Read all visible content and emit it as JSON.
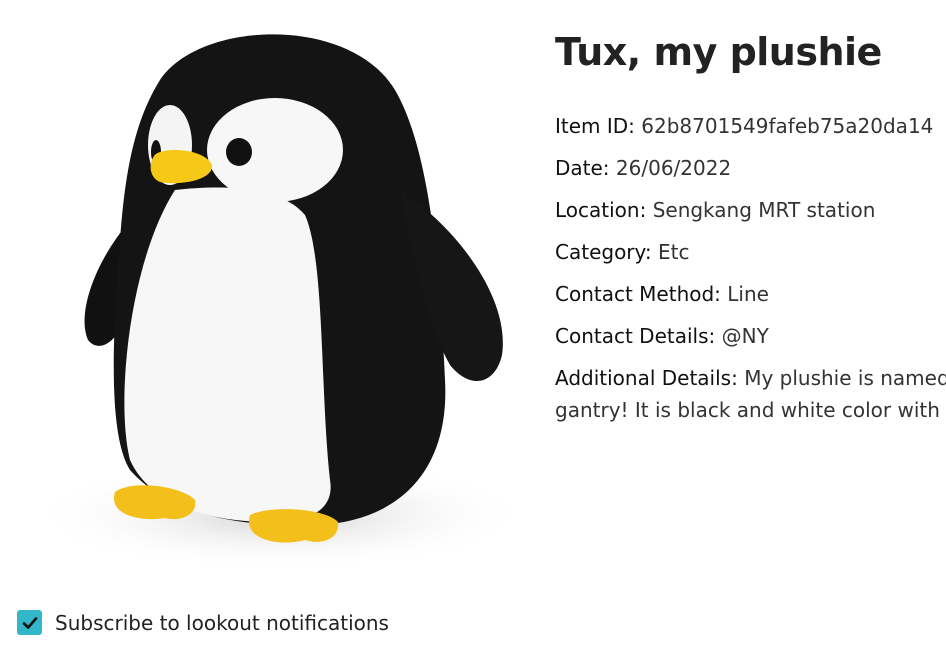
{
  "item": {
    "title": "Tux, my plushie",
    "image_alt": "penguin plushie",
    "fields": [
      {
        "key": "Item ID:",
        "value": "62b8701549fafeb75a20da14"
      },
      {
        "key": "Date:",
        "value": "26/06/2022"
      },
      {
        "key": "Location:",
        "value": "Sengkang MRT station"
      },
      {
        "key": "Category:",
        "value": "Etc"
      },
      {
        "key": "Contact Method:",
        "value": "Line"
      },
      {
        "key": "Contact Details:",
        "value": "@NY"
      }
    ],
    "additional": {
      "key": "Additional Details:",
      "line1": "My plushie is named tu",
      "line2": "gantry! It is black and white color with a st"
    }
  },
  "subscribe": {
    "label": "Subscribe to lookout notifications",
    "checked": true,
    "checkbox_color": "#34b6c9"
  }
}
